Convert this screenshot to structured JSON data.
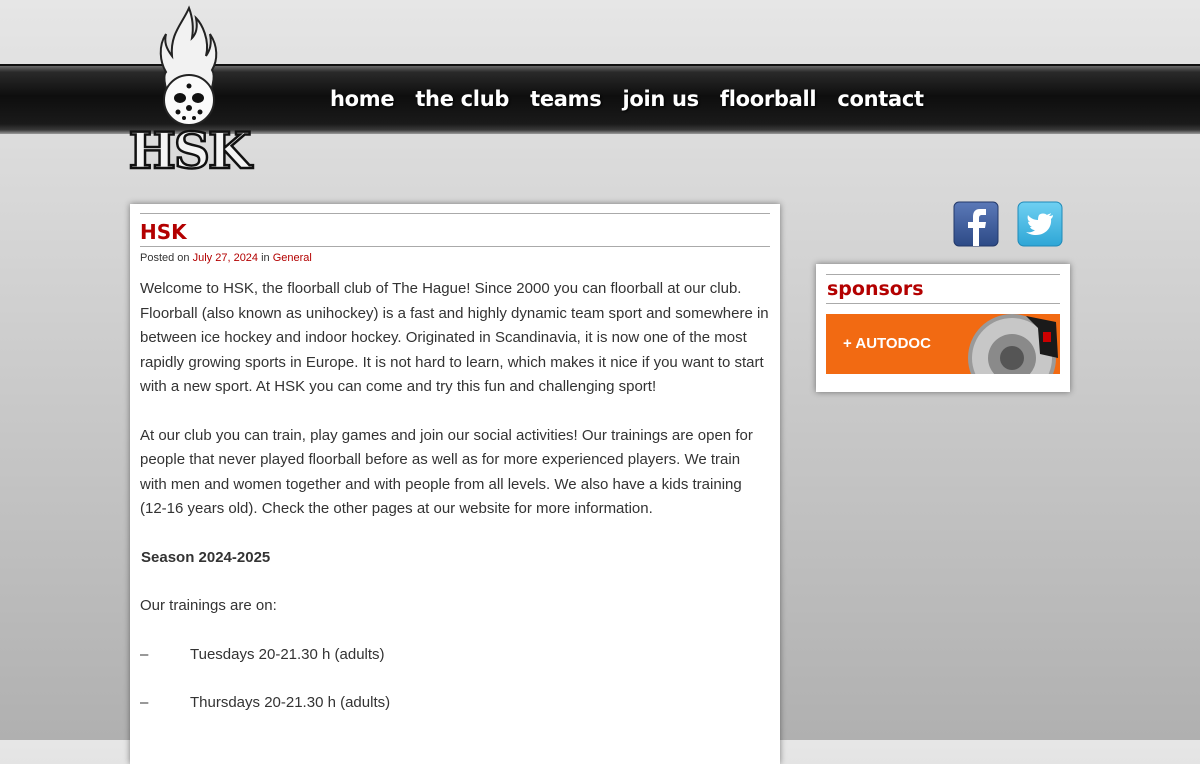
{
  "nav": {
    "items": [
      {
        "label": "home"
      },
      {
        "label": "the club"
      },
      {
        "label": "teams"
      },
      {
        "label": "join us"
      },
      {
        "label": "floorball"
      },
      {
        "label": "contact"
      }
    ]
  },
  "logo": {
    "text": "HSK"
  },
  "post": {
    "title": "HSK",
    "meta_prefix": "Posted on",
    "date": "July 27, 2024",
    "meta_in": "in",
    "category": "General",
    "paragraph1": "Welcome to HSK, the floorball club of The Hague! Since 2000 you can floorball at our club. Floorball (also known as unihockey) is a fast and highly dynamic team sport and somewhere in between ice hockey and indoor hockey. Originated in Scandinavia, it is now one of the most rapidly growing sports in Europe. It is not hard to learn, which makes it nice if you want to start with a new sport. At HSK you can come and try this fun and challenging sport!",
    "paragraph2": "At our club you can train, play games and join our social activities! Our trainings are open for people that never played floorball before as well as for more experienced players. We train with men and women together and with people from all levels. We also have a kids training (12-16 years old). Check the other pages at our website for more information.",
    "season": "Season 2024-2025",
    "trainings_intro": "Our trainings are on:",
    "dash": "–",
    "training1": "Tuesdays 20-21.30 h (adults)",
    "training2": "Thursdays 20-21.30 h (adults)"
  },
  "social": {
    "facebook_icon": "facebook-icon",
    "twitter_icon": "twitter-icon",
    "facebook_color": "#3b5998",
    "twitter_color": "#3fb5e5"
  },
  "sidebar": {
    "title": "sponsors",
    "sponsor_name": "+ AUTODOC",
    "sponsor_color": "#f26a12"
  },
  "colors": {
    "accent": "#b30000",
    "navbar": "#111111"
  }
}
